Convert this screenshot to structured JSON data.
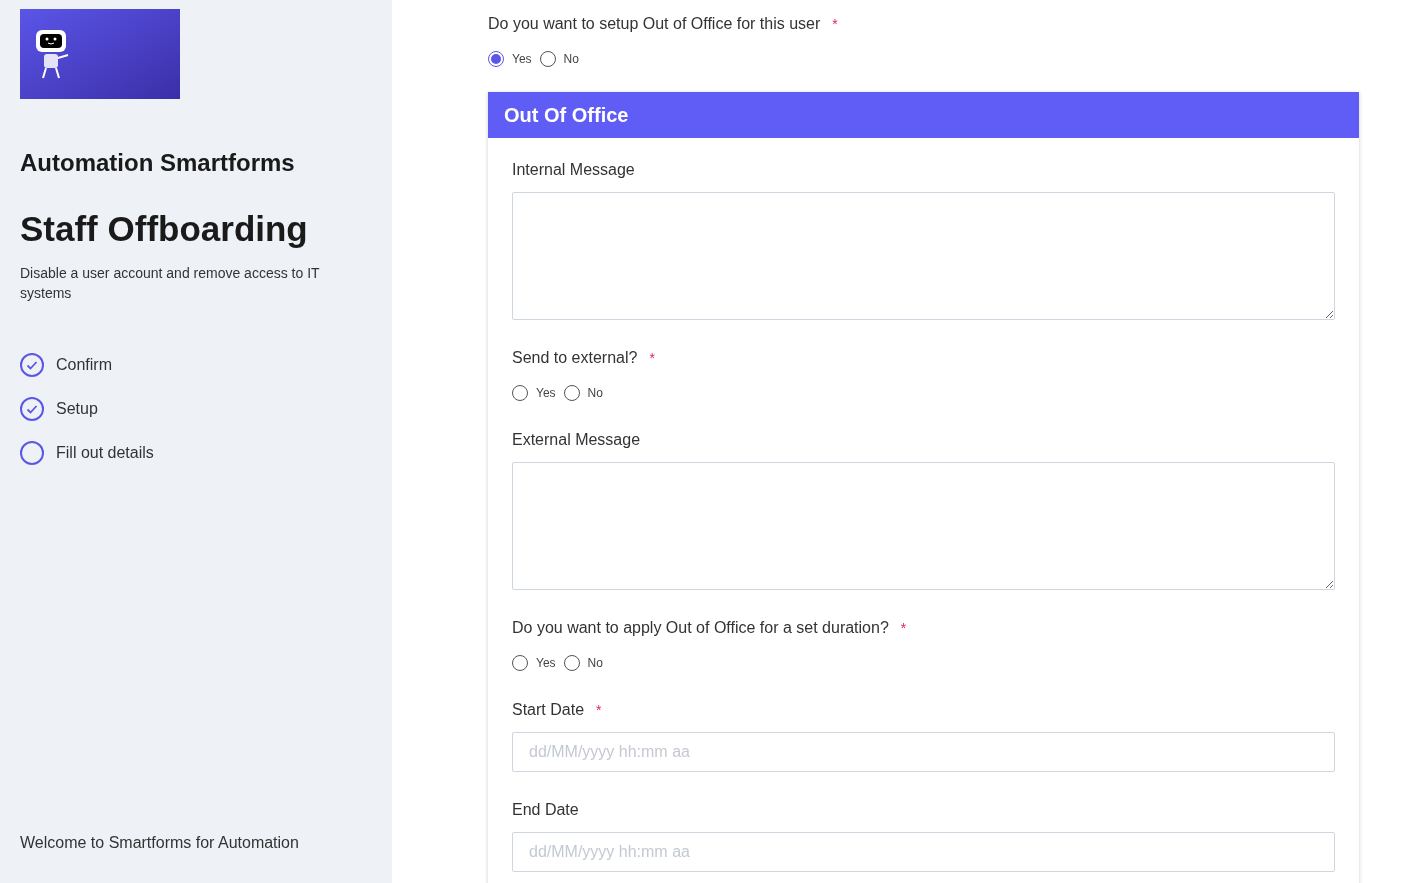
{
  "sidebar": {
    "app_title": "Automation Smartforms",
    "form_title": "Staff Offboarding",
    "description": "Disable a user account and remove access to IT systems",
    "steps": [
      {
        "label": "Confirm",
        "completed": true
      },
      {
        "label": "Setup",
        "completed": true
      },
      {
        "label": "Fill out details",
        "completed": false
      }
    ],
    "footer": "Welcome to Smartforms for Automation"
  },
  "top_question": {
    "label": "Do you want to setup Out of Office for this user",
    "marker": "*",
    "options": [
      {
        "label": "Yes",
        "selected": true
      },
      {
        "label": "No",
        "selected": false
      }
    ]
  },
  "section": {
    "title": "Out Of Office",
    "fields": [
      {
        "kind": "textarea",
        "label": "Internal Message"
      },
      {
        "kind": "radio",
        "label": "Send to external?",
        "marker": "*",
        "options": [
          {
            "label": "Yes",
            "selected": false
          },
          {
            "label": "No",
            "selected": false
          }
        ]
      },
      {
        "kind": "textarea",
        "label": "External Message"
      },
      {
        "kind": "radio",
        "label": "Do you want to apply Out of Office for a set duration?",
        "marker": "*",
        "options": [
          {
            "label": "Yes",
            "selected": false
          },
          {
            "label": "No",
            "selected": false
          }
        ]
      },
      {
        "kind": "date",
        "label": "Start Date",
        "marker": "*",
        "placeholder": "dd/MM/yyyy hh:mm aa"
      },
      {
        "kind": "date",
        "label": "End Date",
        "placeholder": "dd/MM/yyyy hh:mm aa"
      }
    ]
  }
}
